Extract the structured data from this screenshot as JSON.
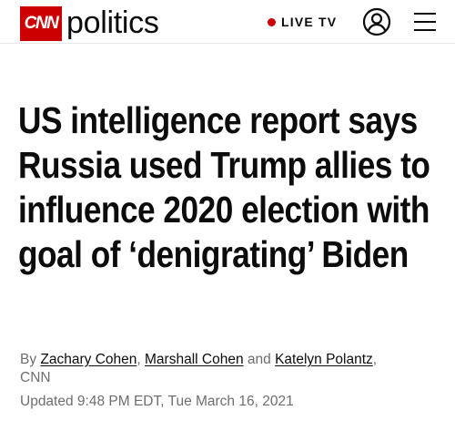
{
  "header": {
    "logo_text": "CNN",
    "section_name": "politics",
    "live_tv_label": "LIVE TV",
    "account_icon": "user-circle-icon",
    "menu_icon": "hamburger-menu-icon"
  },
  "colors": {
    "brand_red": "#cc0000",
    "text": "#0c0c0c",
    "meta": "#6e6e6e"
  },
  "article": {
    "headline": "US intelligence report says Russia used Trump allies to influence 2020 election with goal of ‘denigrating’ Biden",
    "byline": {
      "prefix": "By",
      "authors": [
        "Zachary Cohen",
        "Marshall Cohen",
        "Katelyn Polantz"
      ],
      "separator_1": ",",
      "separator_2": "and",
      "separator_3": ",",
      "outlet": "CNN"
    },
    "updated": "Updated 9:48 PM EDT, Tue March 16, 2021"
  }
}
